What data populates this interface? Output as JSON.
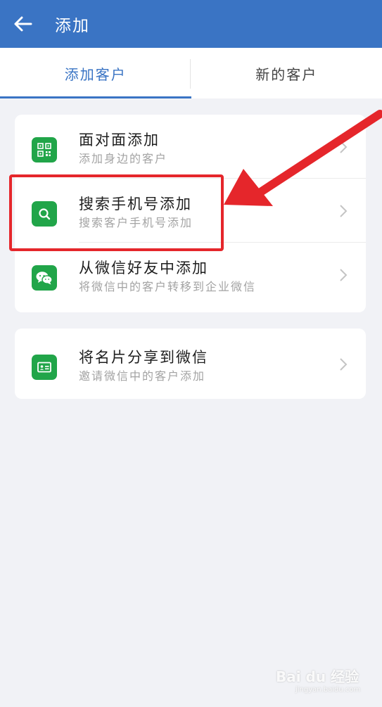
{
  "header": {
    "title": "添加"
  },
  "tabs": [
    {
      "label": "添加客户",
      "active": true
    },
    {
      "label": "新的客户",
      "active": false
    }
  ],
  "groups": [
    {
      "items": [
        {
          "title": "面对面添加",
          "subtitle": "添加身边的客户",
          "icon": "qr-code-icon"
        },
        {
          "title": "搜索手机号添加",
          "subtitle": "搜索客户手机号添加",
          "icon": "search-icon"
        },
        {
          "title": "从微信好友中添加",
          "subtitle": "将微信中的客户转移到企业微信",
          "icon": "wechat-icon"
        }
      ]
    },
    {
      "items": [
        {
          "title": "将名片分享到微信",
          "subtitle": "邀请微信中的客户添加",
          "icon": "business-card-icon"
        }
      ]
    }
  ],
  "watermark": {
    "brand": "Bai du 经验",
    "url": "jingyan.baidu.com"
  },
  "colors": {
    "header": "#3a74c4",
    "accent": "#3a74c4",
    "icon_bg": "#21a549",
    "annotation": "#e5262b",
    "background": "#f1f2f6"
  }
}
